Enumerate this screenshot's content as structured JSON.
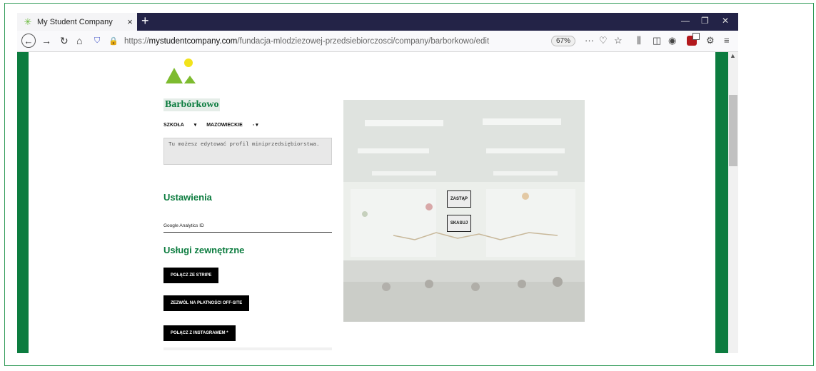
{
  "browser": {
    "tab_title": "My Student Company",
    "url_prefix": "https://",
    "url_domain": "mystudentcompany.com",
    "url_path": "/fundacja-mlodziezowej-przedsiebiorczosci/company/barborkowo/edit",
    "zoom": "67%"
  },
  "page": {
    "company_name": "Barbórkowo",
    "school_dropdown": "SZKOŁA",
    "region_dropdown": "MAZOWIECKIE",
    "description_placeholder": "Tu możesz edytować profil miniprzedsiębiorstwa.",
    "settings_title": "Ustawienia",
    "ga_label": "Google Analytics ID",
    "external_title": "Usługi zewnętrzne",
    "buttons": {
      "stripe": "POŁĄCZ ZE STRIPE",
      "offsite": "ZEZWÓL NA PŁATNOŚCI OFF-SITE",
      "instagram": "POŁĄCZ Z INSTAGRAMEM *"
    },
    "photo_buttons": {
      "replace": "ZASTĄP",
      "delete": "SKASUJ"
    }
  },
  "colors": {
    "brand_green": "#0c7c3f",
    "logo_yellow": "#f2e31b",
    "logo_green": "#7dbb2f",
    "titlebar": "#232347"
  }
}
